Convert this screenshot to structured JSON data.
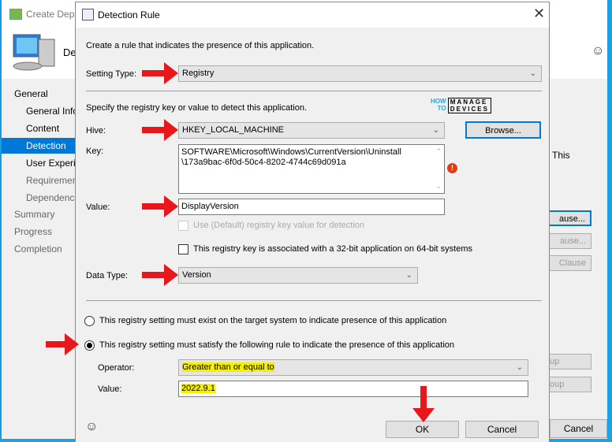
{
  "background_window": {
    "title": "Create Depl",
    "header_text": "De",
    "nav": [
      {
        "label": "General",
        "level": 0,
        "state": "normal"
      },
      {
        "label": "General Info",
        "level": 1,
        "state": "normal"
      },
      {
        "label": "Content",
        "level": 1,
        "state": "normal"
      },
      {
        "label": "Detection M",
        "level": 1,
        "state": "selected"
      },
      {
        "label": "User Experie",
        "level": 1,
        "state": "normal"
      },
      {
        "label": "Requiremen",
        "level": 1,
        "state": "dim"
      },
      {
        "label": "Dependenc",
        "level": 1,
        "state": "dim"
      },
      {
        "label": "Summary",
        "level": 0,
        "state": "dim"
      },
      {
        "label": "Progress",
        "level": 0,
        "state": "dim"
      },
      {
        "label": "Completion",
        "level": 0,
        "state": "dim"
      }
    ],
    "right_text": "This",
    "right_buttons": [
      "ause...",
      "ause...",
      "Clause",
      "up",
      "oup"
    ],
    "cancel_label": "Cancel"
  },
  "dialog": {
    "title": "Detection Rule",
    "intro": "Create a rule that indicates the presence of this application.",
    "setting_type_label": "Setting Type:",
    "setting_type_value": "Registry",
    "specify_text": "Specify the registry key or value to detect this application.",
    "hive_label": "Hive:",
    "hive_value": "HKEY_LOCAL_MACHINE",
    "browse_label": "Browse...",
    "key_label": "Key:",
    "key_value_line1": "SOFTWARE\\Microsoft\\Windows\\CurrentVersion\\Uninstall",
    "key_value_line2": "\\173a9bac-6f0d-50c4-8202-4744c69d091a",
    "value_label": "Value:",
    "value_value": "DisplayVersion",
    "use_default_label": "Use (Default) registry key value for detection",
    "use_default_checked": false,
    "is32bit_label": "This registry key is associated with a 32-bit application on 64-bit systems",
    "is32bit_checked": false,
    "data_type_label": "Data Type:",
    "data_type_value": "Version",
    "radio_exist_label": "This registry setting must exist on the target system to indicate presence of this application",
    "radio_rule_label": "This registry setting must satisfy the following rule to indicate the presence of this application",
    "selected_radio": "rule",
    "operator_label": "Operator:",
    "operator_value": "Greater than or equal to",
    "rule_value_label": "Value:",
    "rule_value": "2022.9.1",
    "ok_label": "OK",
    "cancel_label": "Cancel"
  },
  "watermark": {
    "line1": "HOW",
    "line2": "TO",
    "brand1": "MANAGE",
    "brand2": "DEVICES"
  },
  "colors": {
    "accent": "#0078d7",
    "arrow": "#e8171b",
    "highlight": "#f6f000",
    "error": "#d9401a"
  }
}
